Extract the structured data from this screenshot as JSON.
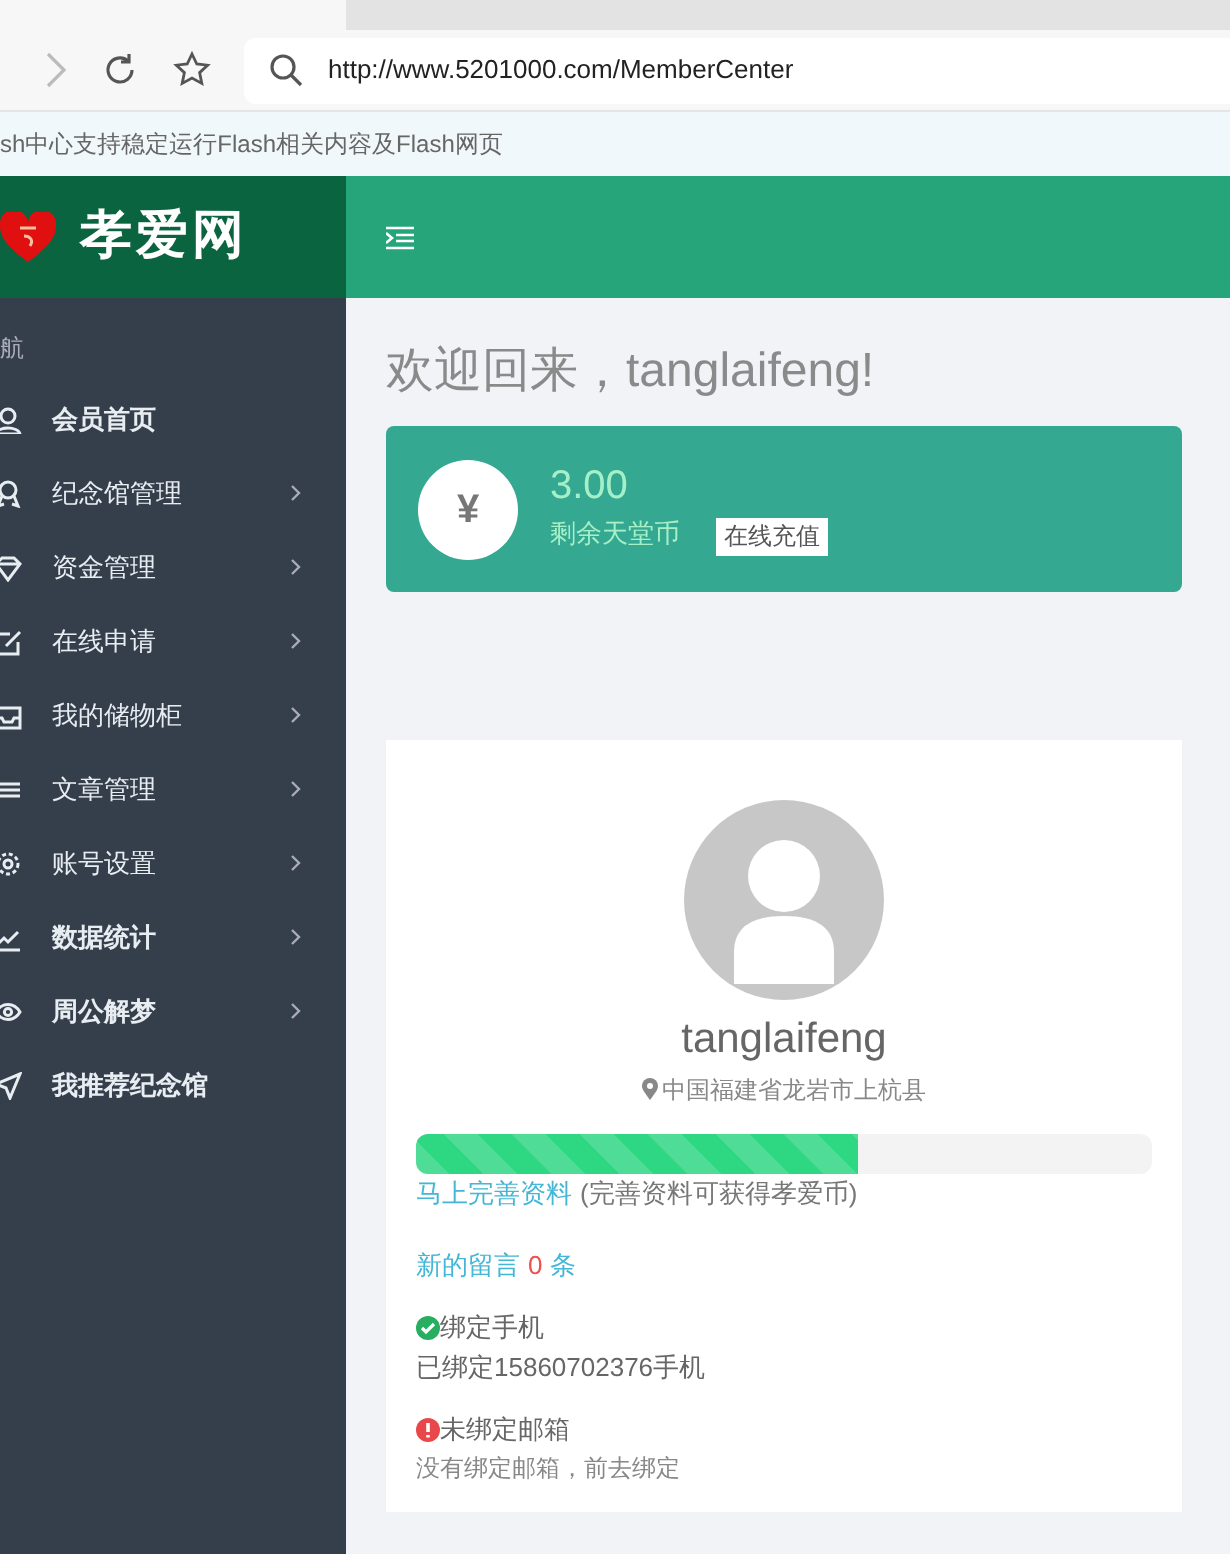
{
  "browser": {
    "url": "http://www.5201000.com/MemberCenter",
    "notice": "sh中心支持稳定运行Flash相关内容及Flash网页"
  },
  "sidebar": {
    "logo": "孝爱网",
    "section": "航",
    "items": [
      {
        "label": "会员首页",
        "kind": "user",
        "emphasized": true,
        "has_submenu": false
      },
      {
        "label": "纪念馆管理",
        "kind": "award",
        "emphasized": false,
        "has_submenu": true
      },
      {
        "label": "资金管理",
        "kind": "diamond",
        "emphasized": false,
        "has_submenu": true
      },
      {
        "label": "在线申请",
        "kind": "edit",
        "emphasized": false,
        "has_submenu": true
      },
      {
        "label": "我的储物柜",
        "kind": "inbox",
        "emphasized": false,
        "has_submenu": true
      },
      {
        "label": "文章管理",
        "kind": "lines",
        "emphasized": false,
        "has_submenu": true
      },
      {
        "label": "账号设置",
        "kind": "gear",
        "emphasized": false,
        "has_submenu": true
      },
      {
        "label": "数据统计",
        "kind": "chart",
        "emphasized": true,
        "has_submenu": true
      },
      {
        "label": "周公解梦",
        "kind": "eye",
        "emphasized": true,
        "has_submenu": true
      },
      {
        "label": "我推荐纪念馆",
        "kind": "send",
        "emphasized": true,
        "has_submenu": false
      }
    ]
  },
  "welcome": "欢迎回来，tanglaifeng!",
  "balance": {
    "symbol": "¥",
    "amount": "3.00",
    "label": "剩余天堂币",
    "button": "在线充值"
  },
  "profile": {
    "username": "tanglaifeng",
    "location": "中国福建省龙岩市上杭县",
    "progress": {
      "level": 0.6
    },
    "complete_link": "马上完善资料",
    "complete_note": "(完善资料可获得孝爱币)",
    "messages": {
      "label": "新的留言",
      "count": "0",
      "unit": "条"
    },
    "bindings": [
      {
        "kind": "ok",
        "title": "绑定手机",
        "detail": "已绑定15860702376手机"
      },
      {
        "kind": "warn",
        "title": "未绑定邮箱",
        "detail": "没有绑定邮箱，前去绑定"
      }
    ]
  }
}
